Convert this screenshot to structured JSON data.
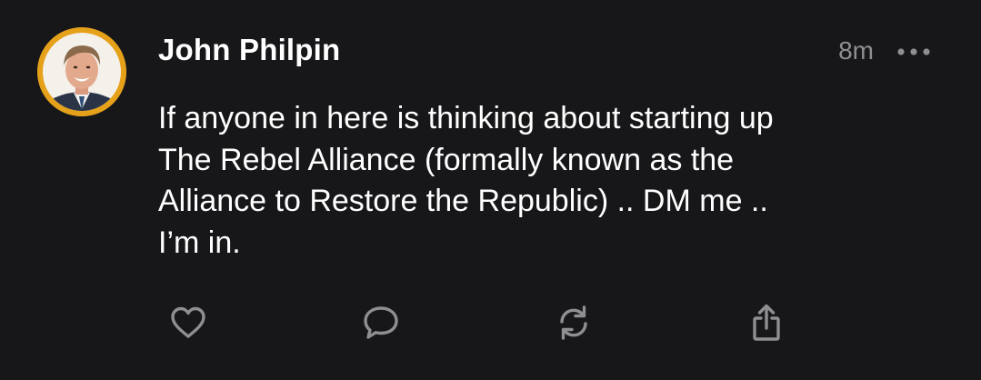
{
  "post": {
    "author": "John Philpin",
    "time": "8m",
    "text": "If anyone in here is thinking about starting up\nThe Rebel Alliance (formally known as the\nAlliance to Restore the Republic) .. DM me ..\nI’m in."
  },
  "icons": {
    "more": "ellipsis-icon",
    "like": "heart-icon",
    "reply": "comment-bubble-icon",
    "repost": "repost-arrows-icon",
    "share": "share-upload-icon"
  },
  "colors": {
    "background": "#17171a",
    "text": "#ffffff",
    "muted": "#8e8e93",
    "avatar_ring": "#e6a11a"
  }
}
